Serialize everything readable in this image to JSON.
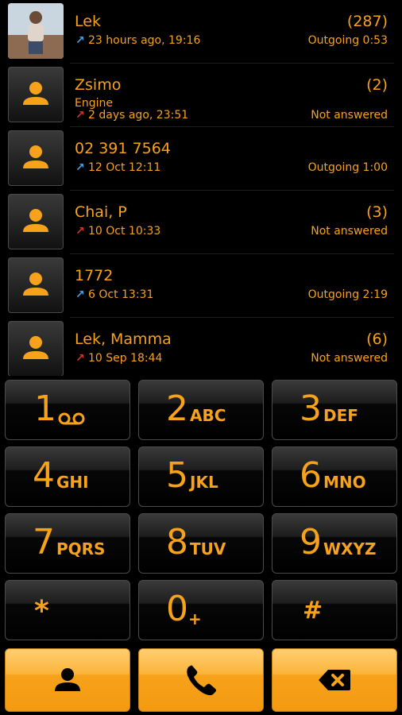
{
  "calls": [
    {
      "name": "Lek",
      "sub": "",
      "count": "(287)",
      "when": "23 hours ago, 19:16",
      "direction": "outgoing",
      "status": "Outgoing 0:53",
      "avatar": "photo"
    },
    {
      "name": "Zsimo",
      "sub": "Engine",
      "count": "(2)",
      "when": "2 days ago, 23:51",
      "direction": "missed",
      "status": "Not answered",
      "avatar": "person-icon"
    },
    {
      "name": "02 391 7564",
      "sub": "",
      "count": "",
      "when": "12 Oct 12:11",
      "direction": "outgoing",
      "status": "Outgoing 1:00",
      "avatar": "person-icon"
    },
    {
      "name": "Chai, P",
      "sub": "",
      "count": "(3)",
      "when": "10 Oct 10:33",
      "direction": "missed",
      "status": "Not answered",
      "avatar": "person-icon"
    },
    {
      "name": "1772",
      "sub": "",
      "count": "",
      "when": "6 Oct 13:31",
      "direction": "outgoing",
      "status": "Outgoing 2:19",
      "avatar": "person-icon"
    },
    {
      "name": "Lek, Mamma",
      "sub": "",
      "count": "(6)",
      "when": "10 Sep 18:44",
      "direction": "missed",
      "status": "Not answered",
      "avatar": "person-icon"
    }
  ],
  "keys": [
    {
      "digit": "1",
      "letters": "",
      "icon": "voicemail-icon"
    },
    {
      "digit": "2",
      "letters": "ABC"
    },
    {
      "digit": "3",
      "letters": "DEF"
    },
    {
      "digit": "4",
      "letters": "GHI"
    },
    {
      "digit": "5",
      "letters": "JKL"
    },
    {
      "digit": "6",
      "letters": "MNO"
    },
    {
      "digit": "7",
      "letters": "PQRS"
    },
    {
      "digit": "8",
      "letters": "TUV"
    },
    {
      "digit": "9",
      "letters": "WXYZ"
    },
    {
      "digit": "*",
      "letters": ""
    },
    {
      "digit": "0",
      "letters": "+"
    },
    {
      "digit": "#",
      "letters": ""
    }
  ],
  "actions": {
    "contacts_icon": "person-icon",
    "call_icon": "phone-icon",
    "delete_icon": "backspace-icon"
  },
  "colors": {
    "accent": "#f7a21b",
    "outgoing_arrow": "#3ea3e6",
    "missed_arrow": "#d0342c",
    "background": "#000000"
  }
}
